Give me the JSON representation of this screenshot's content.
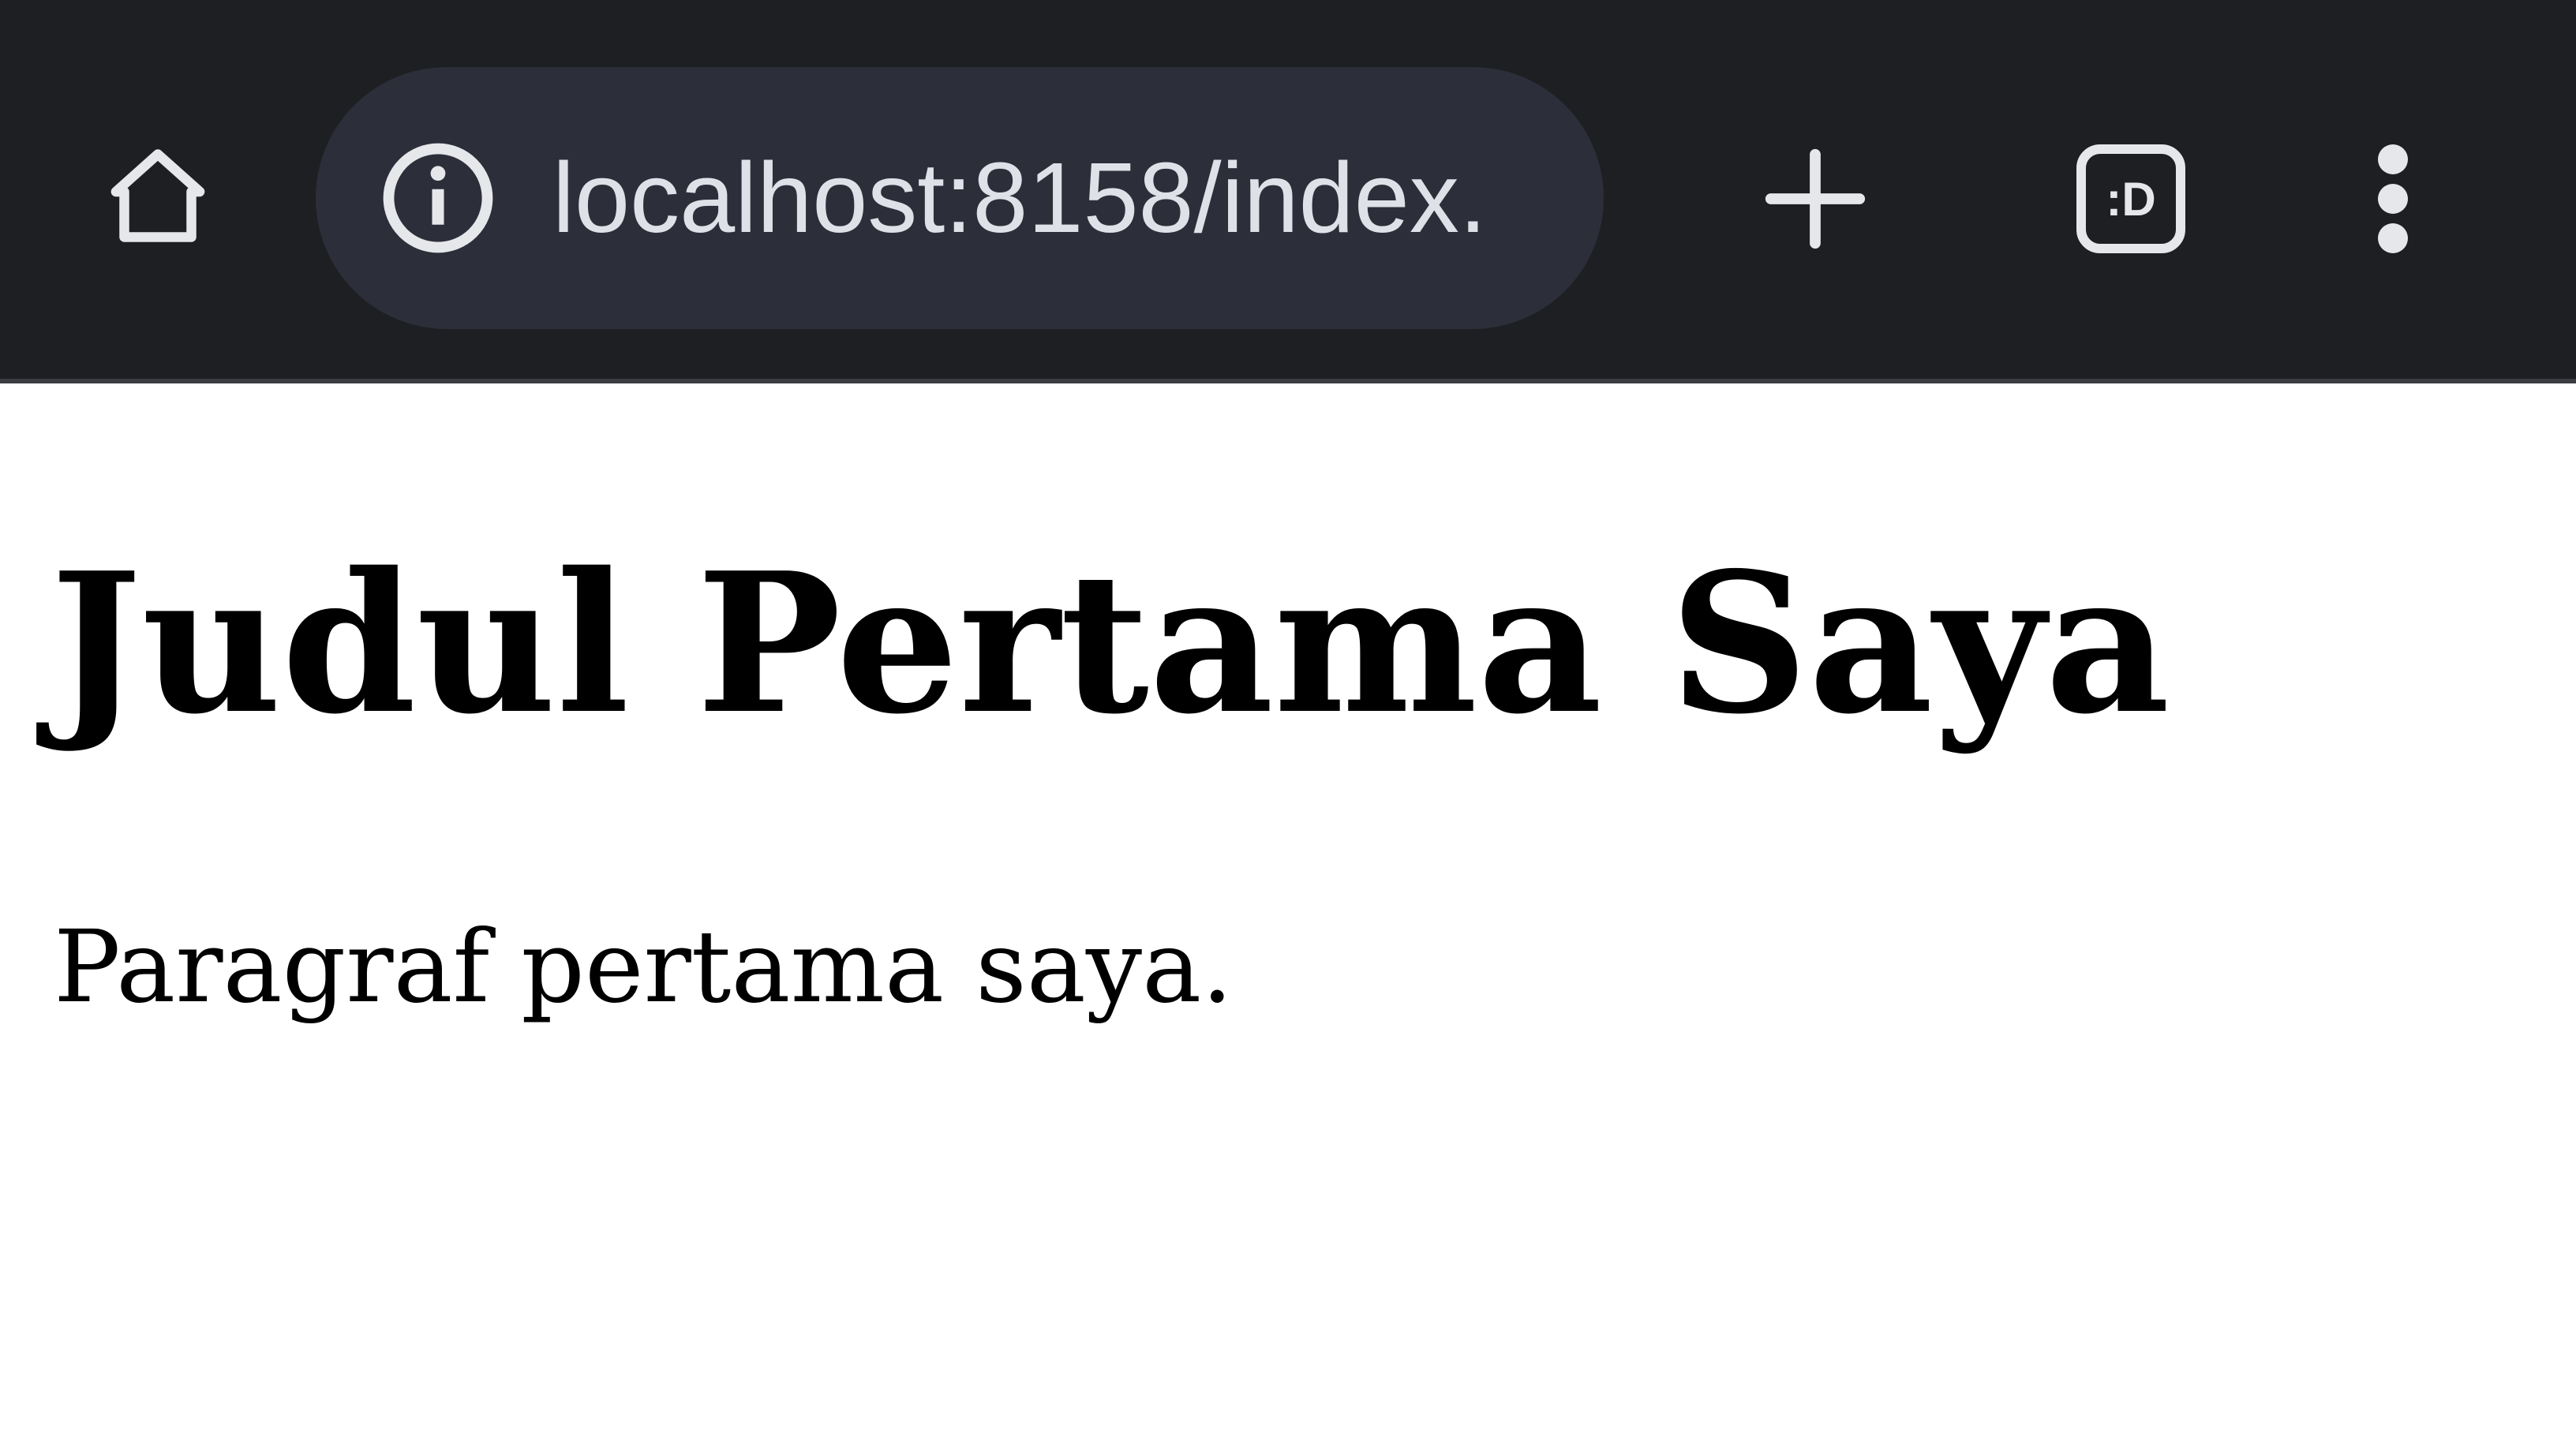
{
  "browser": {
    "url": "localhost:8158/index.",
    "tab_count_label": ":D",
    "icons": {
      "home": "home-icon",
      "site_info": "info-icon",
      "new_tab": "plus-icon",
      "tab_switcher": "tab-switcher-icon",
      "menu": "more-vertical-icon"
    },
    "colors": {
      "toolbar_bg": "#1e1f23",
      "omnibox_bg": "#2c2f39",
      "icon_fg": "#e6e7eb"
    }
  },
  "page": {
    "heading": "Judul Pertama Saya",
    "paragraph": "Paragraf pertama saya."
  }
}
